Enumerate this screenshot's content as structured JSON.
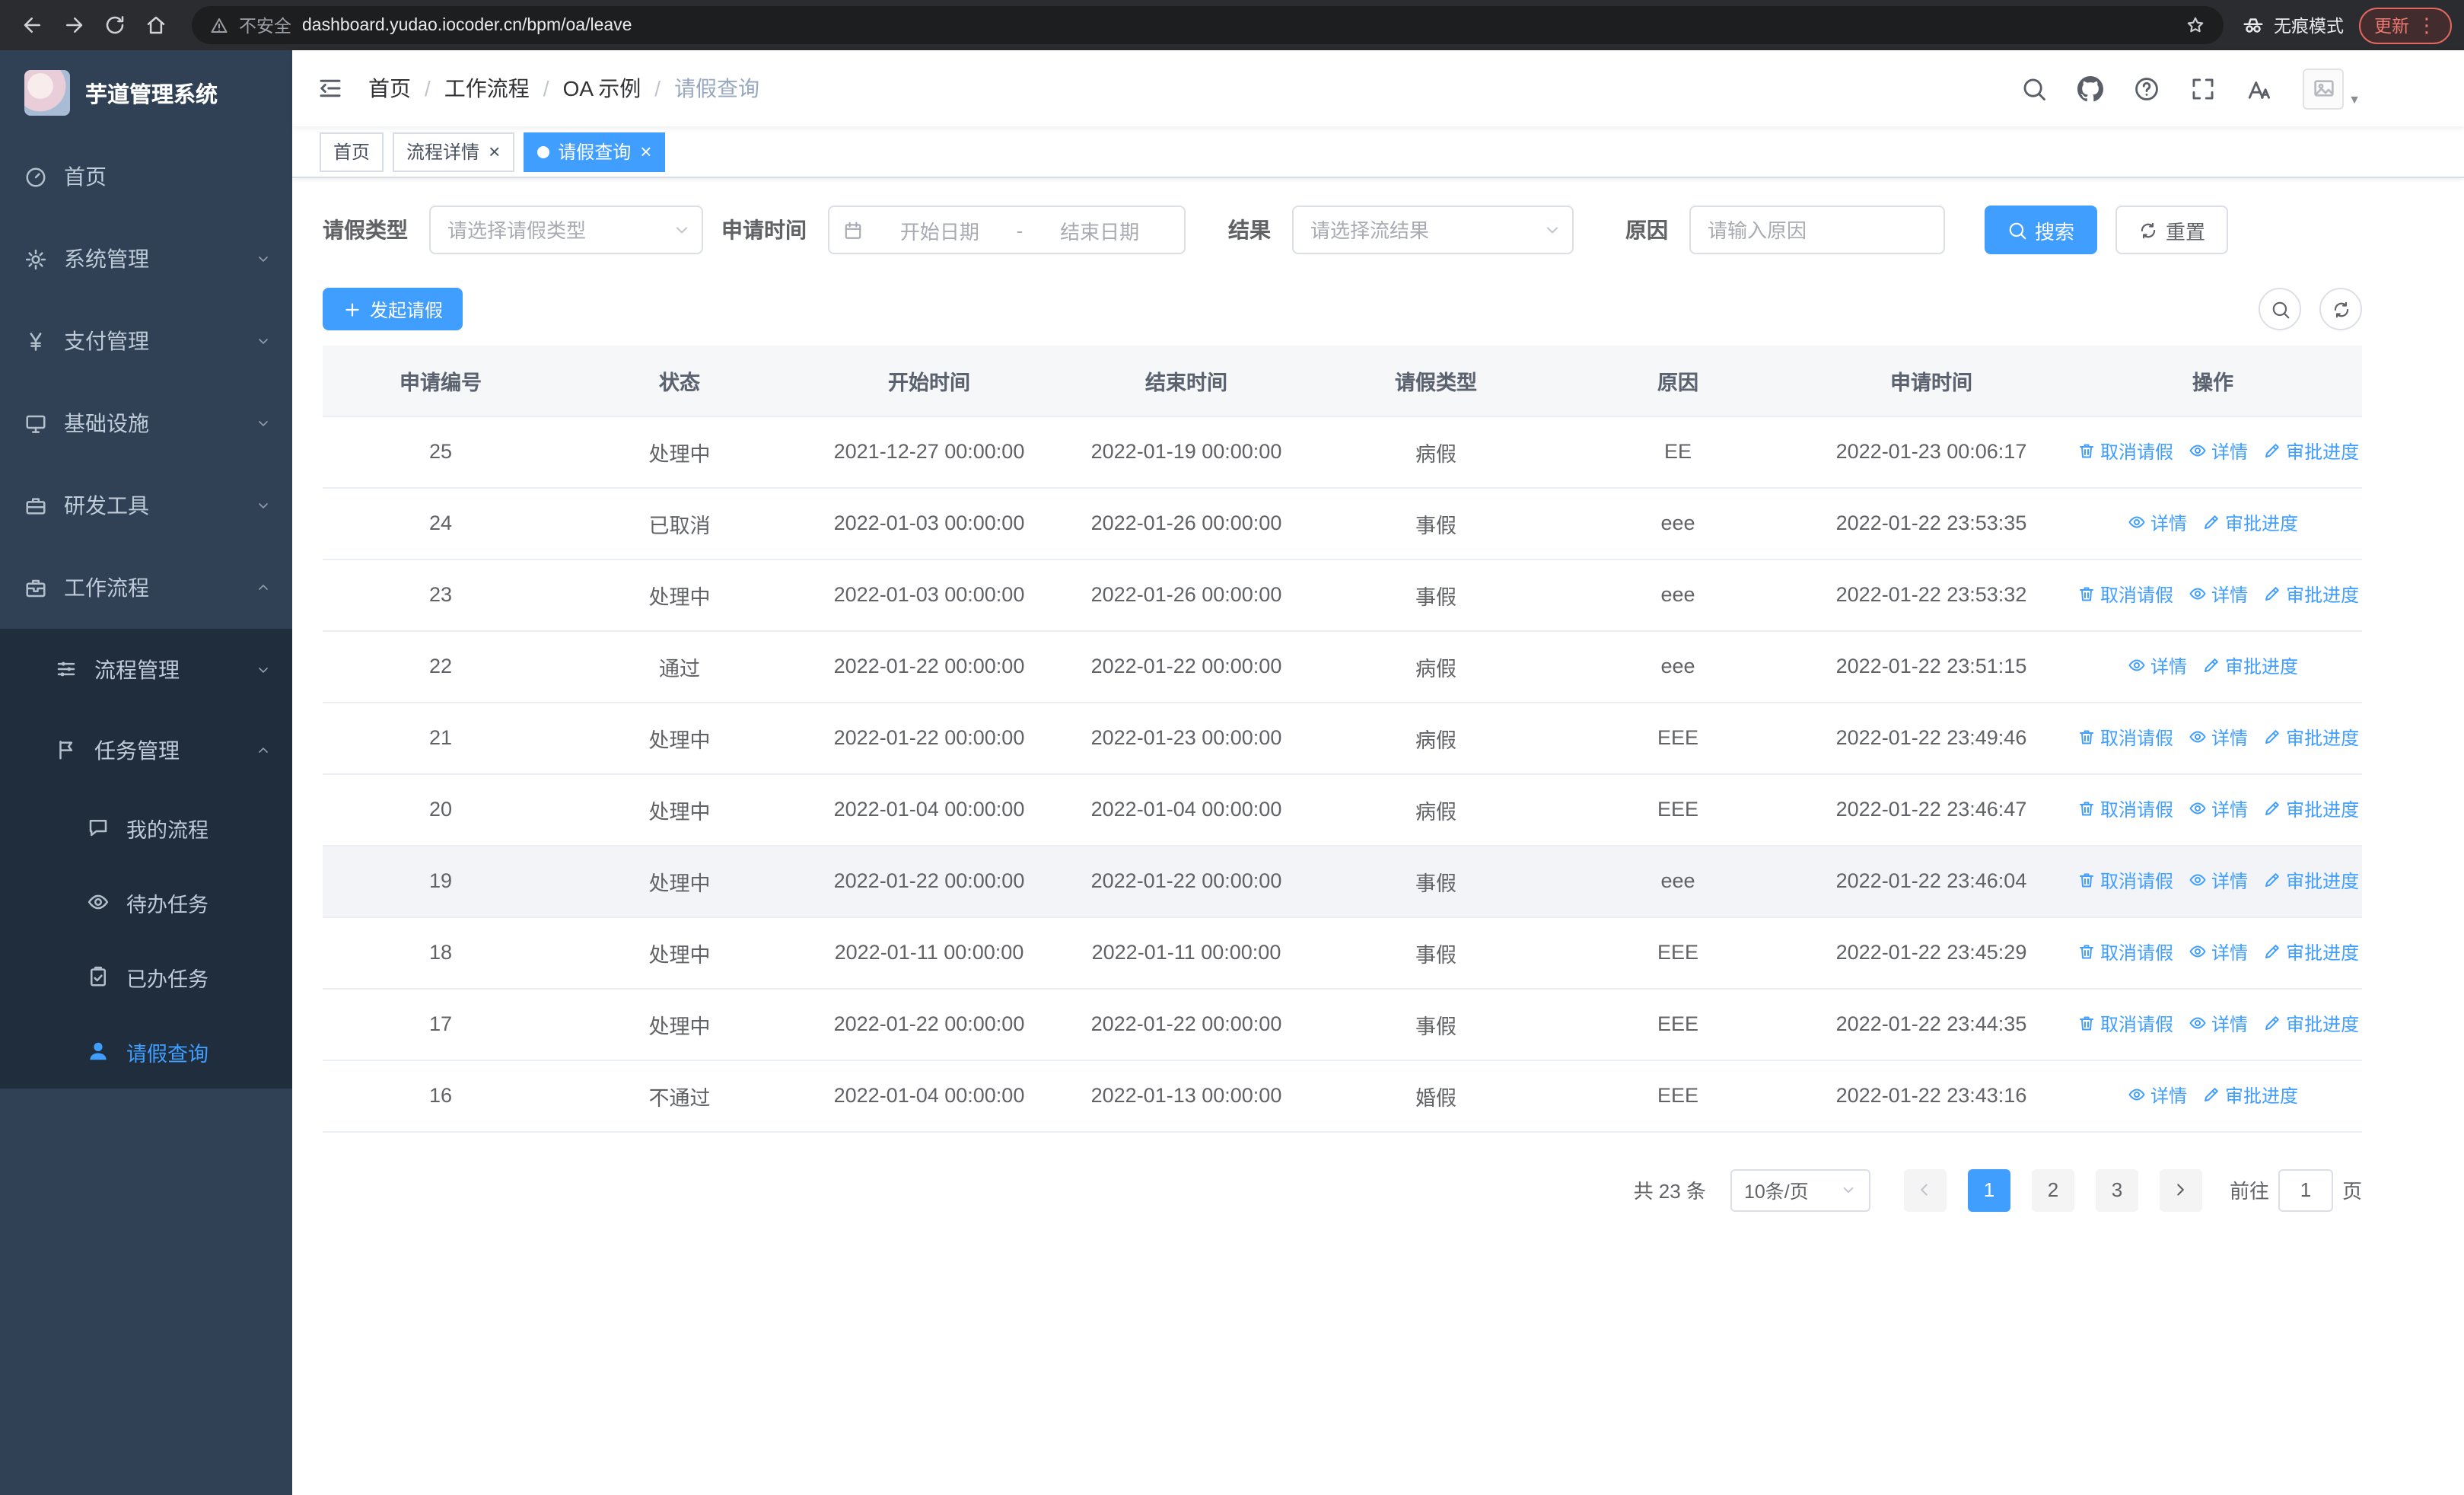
{
  "browser": {
    "security_label": "不安全",
    "url": "dashboard.yudao.iocoder.cn/bpm/oa/leave",
    "incognito_label": "无痕模式",
    "update_label": "更新"
  },
  "sidebar": {
    "logo_title": "芋道管理系统",
    "items": [
      {
        "key": "home",
        "label": "首页",
        "icon": "dashboard-icon",
        "level": 1
      },
      {
        "key": "system-management",
        "label": "系统管理",
        "icon": "gear-icon",
        "level": 1,
        "arrow": "down"
      },
      {
        "key": "payment-management",
        "label": "支付管理",
        "icon": "yen-icon",
        "level": 1,
        "arrow": "down"
      },
      {
        "key": "infrastructure",
        "label": "基础设施",
        "icon": "monitor-icon",
        "level": 1,
        "arrow": "down"
      },
      {
        "key": "dev-tools",
        "label": "研发工具",
        "icon": "toolbox-icon",
        "level": 1,
        "arrow": "down"
      },
      {
        "key": "workflow",
        "label": "工作流程",
        "icon": "briefcase-icon",
        "level": 1,
        "arrow": "up"
      },
      {
        "key": "process-management",
        "label": "流程管理",
        "icon": "sliders-icon",
        "level": 2,
        "arrow": "down"
      },
      {
        "key": "task-management",
        "label": "任务管理",
        "icon": "flag-icon",
        "level": 2,
        "arrow": "up"
      },
      {
        "key": "my-process",
        "label": "我的流程",
        "icon": "chat-icon",
        "level": 3
      },
      {
        "key": "todo-tasks",
        "label": "待办任务",
        "icon": "eye-icon",
        "level": 3
      },
      {
        "key": "done-tasks",
        "label": "已办任务",
        "icon": "clipboard-check-icon",
        "level": 3
      },
      {
        "key": "leave-query",
        "label": "请假查询",
        "icon": "user-icon",
        "level": 3,
        "active": true
      }
    ]
  },
  "navbar": {
    "breadcrumb": [
      "首页",
      "工作流程",
      "OA 示例",
      "请假查询"
    ],
    "icons": [
      "search-icon",
      "github-icon",
      "question-icon",
      "fullscreen-icon",
      "font-size-icon"
    ]
  },
  "tabs": [
    {
      "key": "home",
      "label": "首页",
      "closable": false,
      "active": false
    },
    {
      "key": "process-detail",
      "label": "流程详情",
      "closable": true,
      "active": false
    },
    {
      "key": "leave-query",
      "label": "请假查询",
      "closable": true,
      "active": true
    }
  ],
  "filters": {
    "leave_type_label": "请假类型",
    "leave_type_placeholder": "请选择请假类型",
    "apply_time_label": "申请时间",
    "start_date_placeholder": "开始日期",
    "range_separator": "-",
    "end_date_placeholder": "结束日期",
    "result_label": "结果",
    "result_placeholder": "请选择流结果",
    "reason_label": "原因",
    "reason_placeholder": "请输入原因",
    "search_button": "搜索",
    "reset_button": "重置"
  },
  "toolbar": {
    "create_button": "发起请假"
  },
  "table": {
    "columns": [
      "申请编号",
      "状态",
      "开始时间",
      "结束时间",
      "请假类型",
      "原因",
      "申请时间",
      "操作"
    ],
    "action_labels": {
      "cancel": "取消请假",
      "detail": "详情",
      "progress": "审批进度"
    },
    "rows": [
      {
        "id": "25",
        "status": "处理中",
        "start_time": "2021-12-27 00:00:00",
        "end_time": "2022-01-19 00:00:00",
        "leave_type": "病假",
        "reason": "EE",
        "apply_time": "2022-01-23 00:06:17",
        "cancellable": true
      },
      {
        "id": "24",
        "status": "已取消",
        "start_time": "2022-01-03 00:00:00",
        "end_time": "2022-01-26 00:00:00",
        "leave_type": "事假",
        "reason": "eee",
        "apply_time": "2022-01-22 23:53:35",
        "cancellable": false
      },
      {
        "id": "23",
        "status": "处理中",
        "start_time": "2022-01-03 00:00:00",
        "end_time": "2022-01-26 00:00:00",
        "leave_type": "事假",
        "reason": "eee",
        "apply_time": "2022-01-22 23:53:32",
        "cancellable": true
      },
      {
        "id": "22",
        "status": "通过",
        "start_time": "2022-01-22 00:00:00",
        "end_time": "2022-01-22 00:00:00",
        "leave_type": "病假",
        "reason": "eee",
        "apply_time": "2022-01-22 23:51:15",
        "cancellable": false
      },
      {
        "id": "21",
        "status": "处理中",
        "start_time": "2022-01-22 00:00:00",
        "end_time": "2022-01-23 00:00:00",
        "leave_type": "病假",
        "reason": "EEE",
        "apply_time": "2022-01-22 23:49:46",
        "cancellable": true
      },
      {
        "id": "20",
        "status": "处理中",
        "start_time": "2022-01-04 00:00:00",
        "end_time": "2022-01-04 00:00:00",
        "leave_type": "病假",
        "reason": "EEE",
        "apply_time": "2022-01-22 23:46:47",
        "cancellable": true
      },
      {
        "id": "19",
        "status": "处理中",
        "start_time": "2022-01-22 00:00:00",
        "end_time": "2022-01-22 00:00:00",
        "leave_type": "事假",
        "reason": "eee",
        "apply_time": "2022-01-22 23:46:04",
        "cancellable": true,
        "highlighted": true
      },
      {
        "id": "18",
        "status": "处理中",
        "start_time": "2022-01-11 00:00:00",
        "end_time": "2022-01-11 00:00:00",
        "leave_type": "事假",
        "reason": "EEE",
        "apply_time": "2022-01-22 23:45:29",
        "cancellable": true
      },
      {
        "id": "17",
        "status": "处理中",
        "start_time": "2022-01-22 00:00:00",
        "end_time": "2022-01-22 00:00:00",
        "leave_type": "事假",
        "reason": "EEE",
        "apply_time": "2022-01-22 23:44:35",
        "cancellable": true
      },
      {
        "id": "16",
        "status": "不通过",
        "start_time": "2022-01-04 00:00:00",
        "end_time": "2022-01-13 00:00:00",
        "leave_type": "婚假",
        "reason": "EEE",
        "apply_time": "2022-01-22 23:43:16",
        "cancellable": false
      }
    ]
  },
  "pagination": {
    "total_label": "共 23 条",
    "page_size": "10条/页",
    "pages": [
      "1",
      "2",
      "3"
    ],
    "active_page": "1",
    "goto_label": "前往",
    "goto_value": "1",
    "page_unit": "页"
  },
  "colors": {
    "primary": "#409EFF",
    "sidebar_bg": "#304156",
    "sidebar_sub_bg": "#1f2d3d"
  }
}
